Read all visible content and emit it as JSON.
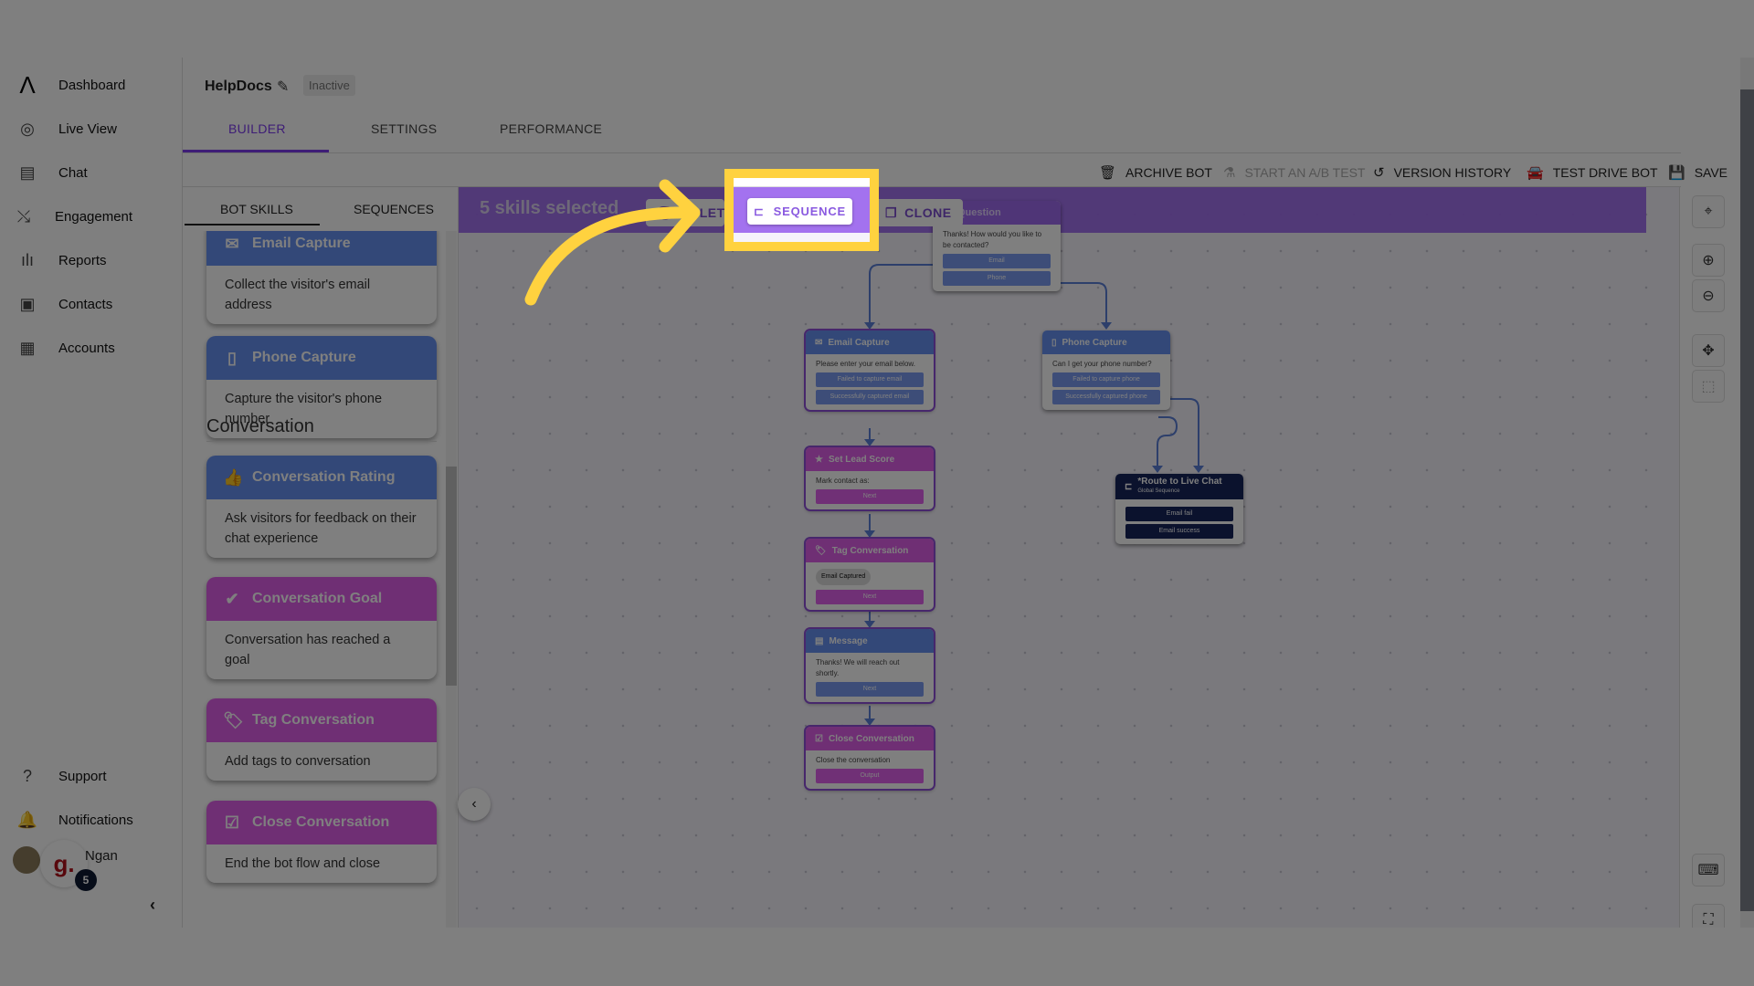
{
  "sidebar": {
    "items": [
      {
        "label": "Dashboard",
        "icon": "logo-icon"
      },
      {
        "label": "Live View",
        "icon": "globe-search-icon"
      },
      {
        "label": "Chat",
        "icon": "chat-icon"
      },
      {
        "label": "Engagement",
        "icon": "strategy-icon"
      },
      {
        "label": "Reports",
        "icon": "bar-chart-icon"
      },
      {
        "label": "Contacts",
        "icon": "contact-card-icon"
      },
      {
        "label": "Accounts",
        "icon": "building-icon"
      }
    ],
    "bottom": [
      {
        "label": "Support",
        "icon": "help-icon"
      },
      {
        "label": "Notifications",
        "icon": "bell-icon"
      }
    ],
    "user": {
      "name": "Ngan",
      "workspace_logo": "g.",
      "badge_count": "5"
    }
  },
  "header": {
    "title": "HelpDocs",
    "status": "Inactive",
    "tabs": [
      {
        "label": "BUILDER",
        "active": true
      },
      {
        "label": "SETTINGS"
      },
      {
        "label": "PERFORMANCE"
      }
    ]
  },
  "toolbar": {
    "archive": "ARCHIVE BOT",
    "ab_test": "START AN A/B TEST",
    "history": "VERSION HISTORY",
    "test_drive": "TEST DRIVE BOT",
    "save": "SAVE"
  },
  "panel": {
    "tabs": [
      "BOT SKILLS",
      "SEQUENCES"
    ],
    "section": "Conversation",
    "cards": [
      {
        "title": "Email Capture",
        "desc": "Collect the visitor's email address",
        "color": "blue"
      },
      {
        "title": "Phone Capture",
        "desc": "Capture the visitor's phone number",
        "color": "blue"
      },
      {
        "title": "Conversation Rating",
        "desc": "Ask visitors for feedback on their chat experience",
        "color": "blue"
      },
      {
        "title": "Conversation Goal",
        "desc": "Conversation has reached a goal",
        "color": "magenta"
      },
      {
        "title": "Tag Conversation",
        "desc": "Add tags to conversation",
        "color": "magenta"
      },
      {
        "title": "Close Conversation",
        "desc": "End the bot flow and close",
        "color": "magenta"
      }
    ]
  },
  "selection": {
    "label": "5 skills selected",
    "delete": "DELETE",
    "sequence": "SEQUENCE",
    "clone": "CLONE"
  },
  "nodes": {
    "question": {
      "title": "Question",
      "text": "Thanks! How would you like to be contacted?",
      "buttons": [
        "Email",
        "Phone"
      ]
    },
    "email": {
      "title": "Email Capture",
      "text": "Please enter your email below.",
      "buttons": [
        "Failed to capture email",
        "Successfully captured email"
      ]
    },
    "phone": {
      "title": "Phone Capture",
      "text": "Can I get your phone number?",
      "buttons": [
        "Failed to capture phone",
        "Successfully captured phone"
      ]
    },
    "lead": {
      "title": "Set Lead Score",
      "text": "Mark contact as:",
      "buttons": [
        "Next"
      ]
    },
    "tag": {
      "title": "Tag Conversation",
      "tag": "Email Captured",
      "buttons": [
        "Next"
      ]
    },
    "message": {
      "title": "Message",
      "text": "Thanks! We will reach out shortly.",
      "buttons": [
        "Next"
      ]
    },
    "close": {
      "title": "Close Conversation",
      "text": "Close the conversation",
      "buttons": [
        "Output"
      ]
    },
    "route": {
      "title": "*Route to Live Chat",
      "subtitle": "Global Sequence",
      "buttons": [
        "Email fail",
        "Email success"
      ]
    }
  },
  "colors": {
    "accent": "#7c3aed",
    "selection_bar": "#9e6aee",
    "node_blue": "#6690f0",
    "node_magenta": "#de5ee8",
    "sequence_navy": "#17245a",
    "highlight": "#ffd23f"
  }
}
